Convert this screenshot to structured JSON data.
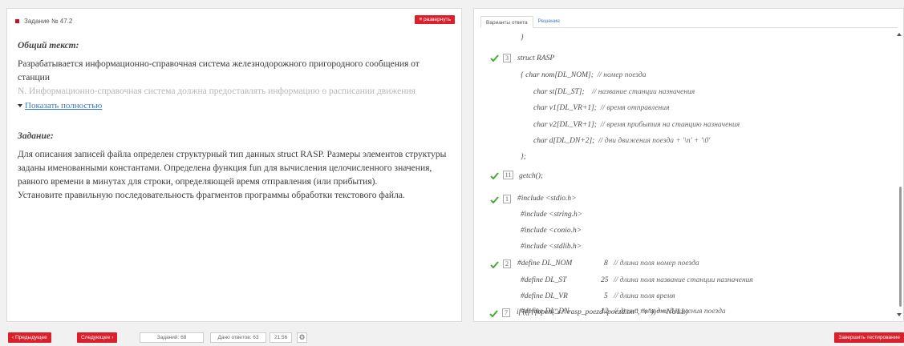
{
  "task_panel": {
    "task_number": "Задание № 47.2",
    "collapse_label": "≡ развернуть",
    "common_text_title": "Общий текст:",
    "common_text_line1": "Разрабатывается информационно-справочная система железнодорожного пригородного сообщения от станции",
    "common_text_line2_faded": "N. Информационно-справочная система должна предоставлять информацию о расписании движения",
    "show_more": "Показать полностью",
    "task_title": "Задание:",
    "task_lines": [
      "Для описания записей файла определен структурный тип данных struct RASP. Размеры элементов структуры",
      "заданы именованными константами. Определена функция fun для вычисления целочисленного значения,",
      "равного времени в минутах для строки, определяющей время отправления (или прибытия).",
      "Установите правильную последовательность фрагментов программы обработки текстового файла."
    ]
  },
  "answer_panel": {
    "tabs": [
      "Варианты ответа",
      "Решение"
    ],
    "code": {
      "top_brace": "}",
      "struct_header": "struct RASP",
      "struct_line1_code": "{  char  nom[DL_NOM];",
      "struct_line1_comment": "// номер поезда",
      "struct_line2_code": "char  st[DL_ST];",
      "struct_line2_comment": "// название станции назначения",
      "struct_line3_code": "char v1[DL_VR+1];",
      "struct_line3_comment": "// время отправления",
      "struct_line4_code": "char v2[DL_VR+1];",
      "struct_line4_comment": "// время прибытия на станцию назначения",
      "struct_line5_code": "char  d[DL_DN+2];",
      "struct_line5_comment": "// дни движения поезда + '\\n' + '\\0'",
      "struct_end": "};",
      "getch": "getch();",
      "inc1": "#include <stdio.h>",
      "inc2": "#include <string.h>",
      "inc3": "#include <conio.h>",
      "inc4": "#include <stdlib.h>",
      "def1_code": "#define  DL_NOM",
      "def1_val": "8",
      "def1_comment": "// длина поля номер поезда",
      "def2_code": "#define  DL_ST",
      "def2_val": "25",
      "def2_comment": "// длина поля название станции назначения",
      "def3_code": "#define  DL_VR",
      "def3_val": "5",
      "def3_comment": "// длина поля время",
      "def4_code": "#define  DL_DN",
      "def4_val": "12",
      "def4_comment": "// длина поля дни движения поезда",
      "fopen_line": "if ((f=fopen(\"c:\\\\rasp_poezd\\\\poezd.txt\", \"r\"))==NULL)"
    },
    "order_numbers": {
      "struct": "3",
      "getch": "11",
      "includes": "1",
      "defines": "2",
      "fopen": "7"
    }
  },
  "bottom_bar": {
    "prev_label": "‹ Предыдущее",
    "next_label": "Следующее ›",
    "tasks_count": "Заданий: 68",
    "answers_given": "Дано ответов: 63",
    "timer": "21:56",
    "finish_label": "Завершить тестирование"
  },
  "colors": {
    "accent_red": "#d9202c",
    "check_green": "#4aa83a",
    "link_blue": "#3a7bbf"
  }
}
